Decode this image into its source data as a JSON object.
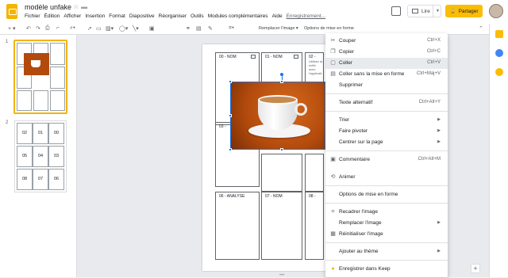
{
  "app": {
    "doc_title": "modèle unfake",
    "menus": [
      "Fichier",
      "Édition",
      "Afficher",
      "Insertion",
      "Format",
      "Diapositive",
      "Réorganiser",
      "Outils",
      "Modules complémentaires",
      "Aide"
    ],
    "last_edit": "Enregistrement...",
    "present_label": "Lire",
    "share_label": "Partager"
  },
  "toolbar": {
    "replace_image": "Remplacer l'image ▾",
    "format_options": "Options de mise en forme"
  },
  "filmstrip": {
    "slides": [
      {
        "number": "1"
      },
      {
        "number": "2",
        "cells": [
          "02",
          "01",
          "00",
          "05",
          "04",
          "03",
          "08",
          "07",
          "06"
        ]
      }
    ]
  },
  "slide": {
    "cells": [
      {
        "label": "00 - NOM"
      },
      {
        "label": "01 - NOM"
      },
      {
        "label": "02 -"
      },
      {
        "label": "03 -"
      },
      {
        "label": "06 - ANALYSE"
      },
      {
        "label": "07 - NOM"
      },
      {
        "label": "08 -"
      }
    ],
    "note_text": [
      "Utilisez la méth",
      "avec l'applicati"
    ]
  },
  "context_menu": {
    "items": [
      {
        "icon": "scissors-icon",
        "glyph": "✂",
        "label": "Couper",
        "shortcut": "Ctrl+X"
      },
      {
        "icon": "copy-icon",
        "glyph": "❐",
        "label": "Copier",
        "shortcut": "Ctrl+C"
      },
      {
        "icon": "paste-icon",
        "glyph": "📋",
        "label": "Coller",
        "shortcut": "Ctrl+V",
        "highlighted": true
      },
      {
        "icon": "paste-plain-icon",
        "glyph": "▤",
        "label": "Coller sans la mise en forme",
        "shortcut": "Ctrl+Maj+V"
      },
      {
        "icon": "",
        "glyph": "",
        "label": "Supprimer",
        "shortcut": ""
      },
      {
        "icon": "",
        "glyph": "",
        "label": "Texte alternatif",
        "shortcut": "Ctrl+Alt+Y"
      },
      {
        "icon": "",
        "glyph": "",
        "label": "Trier",
        "shortcut": "",
        "submenu": true
      },
      {
        "icon": "",
        "glyph": "",
        "label": "Faire pivoter",
        "shortcut": "",
        "submenu": true
      },
      {
        "icon": "",
        "glyph": "",
        "label": "Centrer sur la page",
        "shortcut": "",
        "submenu": true
      },
      {
        "icon": "comment-icon",
        "glyph": "▣",
        "label": "Commentaire",
        "shortcut": "Ctrl+Alt+M"
      },
      {
        "icon": "animate-icon",
        "glyph": "⟲",
        "label": "Animer",
        "shortcut": ""
      },
      {
        "icon": "",
        "glyph": "",
        "label": "Options de mise en forme",
        "shortcut": ""
      },
      {
        "icon": "crop-icon",
        "glyph": "⌗",
        "label": "Recadrer l'image",
        "shortcut": ""
      },
      {
        "icon": "",
        "glyph": "",
        "label": "Remplacer l'image",
        "shortcut": "",
        "submenu": true
      },
      {
        "icon": "reset-image-icon",
        "glyph": "▦",
        "label": "Réinitialiser l'image",
        "shortcut": ""
      },
      {
        "icon": "",
        "glyph": "",
        "label": "Ajouter au thème",
        "shortcut": "",
        "submenu": true
      },
      {
        "icon": "keep-icon",
        "glyph": "●",
        "label": "Enregistrer dans Keep",
        "shortcut": ""
      }
    ]
  },
  "colors": {
    "accent_yellow": "#f4b400",
    "share_yellow": "#fbbc04",
    "selection_blue": "#1a73e8",
    "cursor_highlight": "#fbe300"
  }
}
